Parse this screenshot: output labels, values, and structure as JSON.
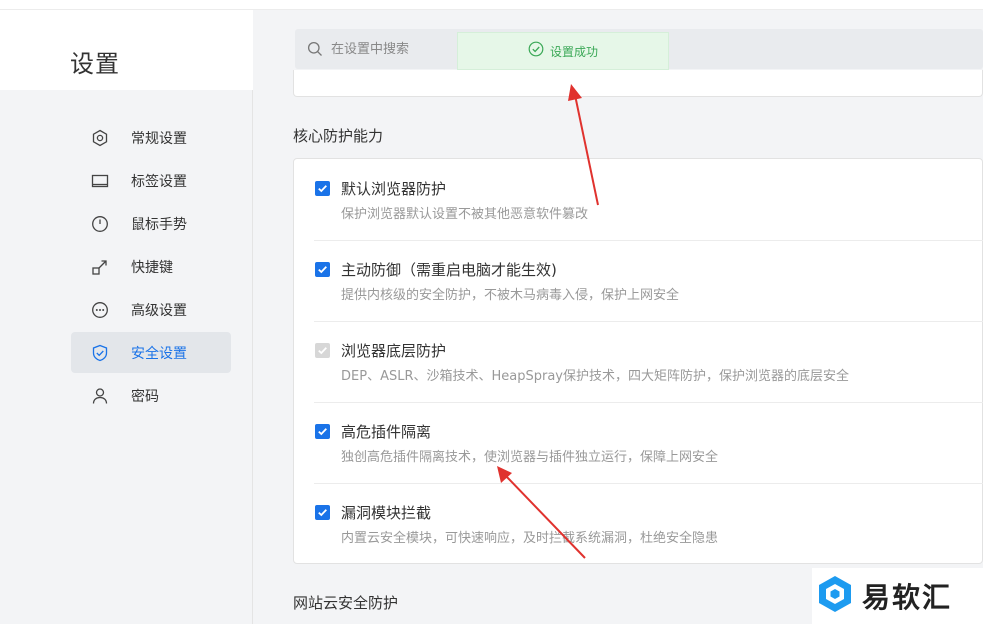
{
  "page": {
    "title": "设置"
  },
  "search": {
    "placeholder": "在设置中搜索"
  },
  "toast": {
    "text": "设置成功"
  },
  "sidebar": {
    "items": [
      {
        "label": "常规设置",
        "icon": "hexagon-gear-icon"
      },
      {
        "label": "标签设置",
        "icon": "tab-window-icon"
      },
      {
        "label": "鼠标手势",
        "icon": "mouse-icon"
      },
      {
        "label": "快捷键",
        "icon": "shortcut-arrow-icon"
      },
      {
        "label": "高级设置",
        "icon": "more-circle-icon"
      },
      {
        "label": "安全设置",
        "icon": "shield-check-icon",
        "active": true
      },
      {
        "label": "密码",
        "icon": "user-icon"
      }
    ]
  },
  "sections": {
    "core": {
      "title": "核心防护能力",
      "options": [
        {
          "title": "默认浏览器防护",
          "desc": "保护浏览器默认设置不被其他恶意软件篡改",
          "checked": true,
          "disabled": false
        },
        {
          "title": "主动防御（需重启电脑才能生效)",
          "desc": "提供内核级的安全防护，不被木马病毒入侵，保护上网安全",
          "checked": true,
          "disabled": false
        },
        {
          "title": "浏览器底层防护",
          "desc": "DEP、ASLR、沙箱技术、HeapSpray保护技术，四大矩阵防护，保护浏览器的底层安全",
          "checked": true,
          "disabled": true
        },
        {
          "title": "高危插件隔离",
          "desc": "独创高危插件隔离技术，使浏览器与插件独立运行，保障上网安全",
          "checked": true,
          "disabled": false
        },
        {
          "title": "漏洞模块拦截",
          "desc": "内置云安全模块，可快速响应，及时拦截系统漏洞，杜绝安全隐患",
          "checked": true,
          "disabled": false
        }
      ]
    },
    "website": {
      "title": "网站云安全防护"
    }
  },
  "watermark": {
    "text": "易软汇"
  },
  "colors": {
    "accent": "#1a73e8",
    "success": "#3aa856",
    "arrow": "#e0322e"
  }
}
